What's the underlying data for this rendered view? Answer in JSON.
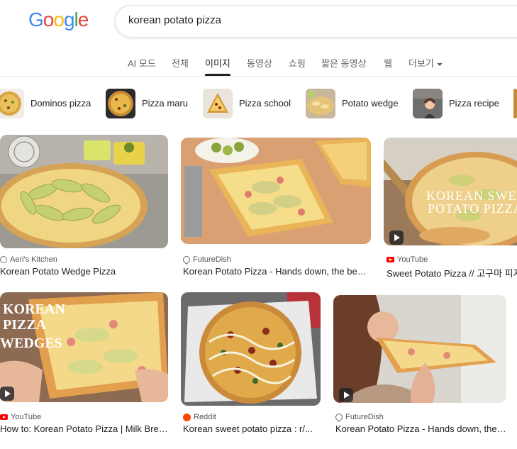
{
  "search": {
    "query": "korean potato pizza"
  },
  "tabs": [
    {
      "label": "AI 모드"
    },
    {
      "label": "전체"
    },
    {
      "label": "이미지"
    },
    {
      "label": "동영상"
    },
    {
      "label": "쇼핑"
    },
    {
      "label": "짧은 동영상"
    },
    {
      "label": "웹"
    },
    {
      "label": "더보기"
    }
  ],
  "chips": [
    {
      "label": "Dominos pizza"
    },
    {
      "label": "Pizza maru"
    },
    {
      "label": "Pizza school"
    },
    {
      "label": "Potato wedge"
    },
    {
      "label": "Pizza recipe"
    }
  ],
  "results": [
    {
      "source": "Aeri's Kitchen",
      "title": "Korean Potato Wedge Pizza",
      "source_icon": "globe-icon"
    },
    {
      "source": "FutureDish",
      "title": "Korean Potato Pizza - Hands down, the best ...",
      "source_icon": "futuredish-icon"
    },
    {
      "source": "YouTube",
      "title": "Sweet Potato Pizza // 고구마 피자",
      "source_icon": "youtube-icon",
      "image_text": "KOREAN SWEET POTATO PIZZA"
    },
    {
      "source": "YouTube",
      "title": "How to: Korean Potato Pizza | Milk Bread ...",
      "source_icon": "youtube-icon",
      "image_text": "KOREAN PIZZA WEDGES"
    },
    {
      "source": "Reddit",
      "title": "Korean sweet potato pizza : r/...",
      "source_icon": "reddit-icon"
    },
    {
      "source": "FutureDish",
      "title": "Korean Potato Pizza - Hands down, the best ...",
      "source_icon": "futuredish-icon"
    }
  ],
  "colors": {
    "logo_blue": "#4285F4",
    "logo_red": "#EA4335",
    "logo_yellow": "#FBBC05",
    "logo_green": "#34A853"
  }
}
